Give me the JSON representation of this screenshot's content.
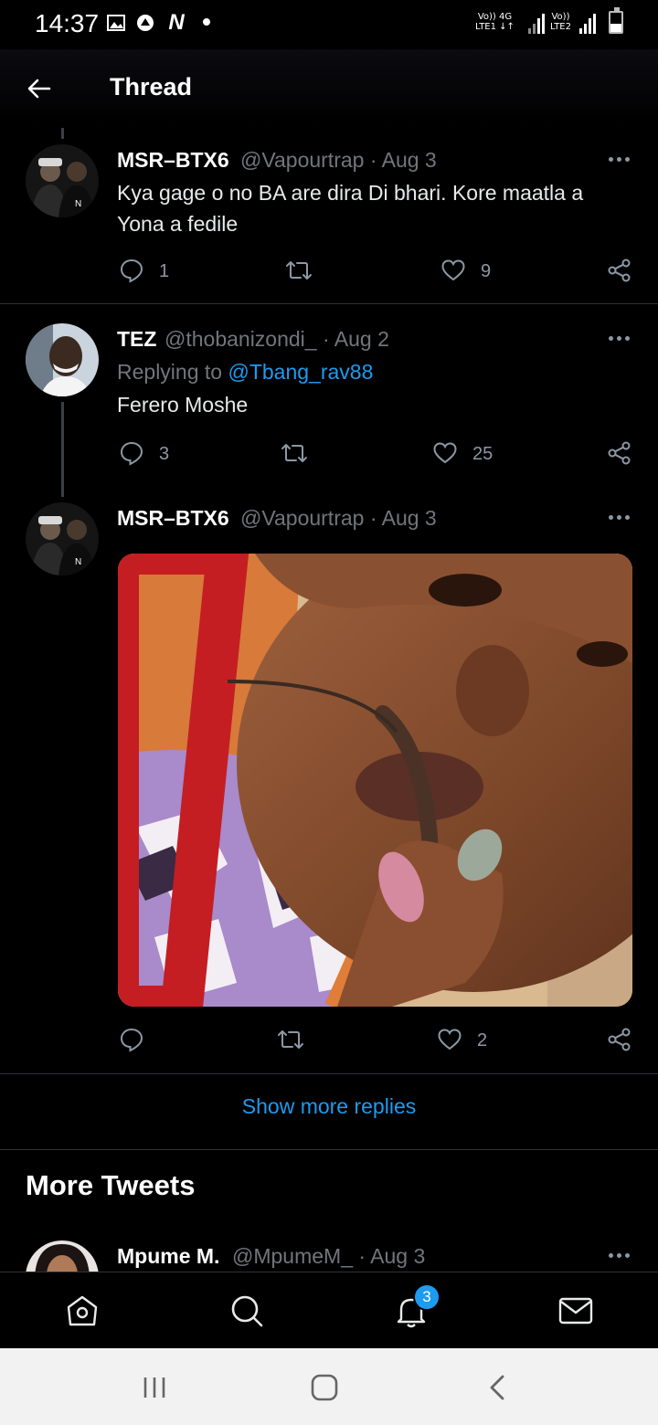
{
  "status_bar": {
    "time": "14:37",
    "net1_top": "Vo)) 4G",
    "net1_bottom": "LTE1 ↓↑",
    "net2_top": "Vo))",
    "net2_bottom": "LTE2"
  },
  "header": {
    "title": "Thread"
  },
  "tweets": [
    {
      "name": "MSR–BTX6",
      "handle": "@Vapourtrap · Aug 3",
      "text": "Kya gage o no BA are dira Di bhari. Kore maatla a Yona a fedile",
      "replies": "1",
      "retweets": "",
      "likes": "9"
    },
    {
      "name": "TEZ",
      "handle": "@thobanizondi_ · Aug 2",
      "replying_prefix": "Replying to",
      "replying_handle": "@Tbang_rav88",
      "text": "Ferero Moshe",
      "replies": "3",
      "retweets": "",
      "likes": "25"
    },
    {
      "name": "MSR–BTX6",
      "handle": "@Vapourtrap · Aug 3",
      "has_image": true,
      "replies": "",
      "retweets": "",
      "likes": "2"
    }
  ],
  "show_more": "Show more replies",
  "more_tweets": {
    "heading": "More Tweets",
    "preview": {
      "name": "Mpume M.",
      "handle": "@MpumeM_ · Aug 3"
    }
  },
  "bottom_nav": {
    "items": [
      "home-icon",
      "search-icon",
      "notifications-icon",
      "messages-icon"
    ],
    "notification_badge": "3"
  },
  "colors": {
    "accent": "#1d9bf0",
    "background": "#000000",
    "secondary_text": "#71767b",
    "divider": "#2f3336"
  }
}
